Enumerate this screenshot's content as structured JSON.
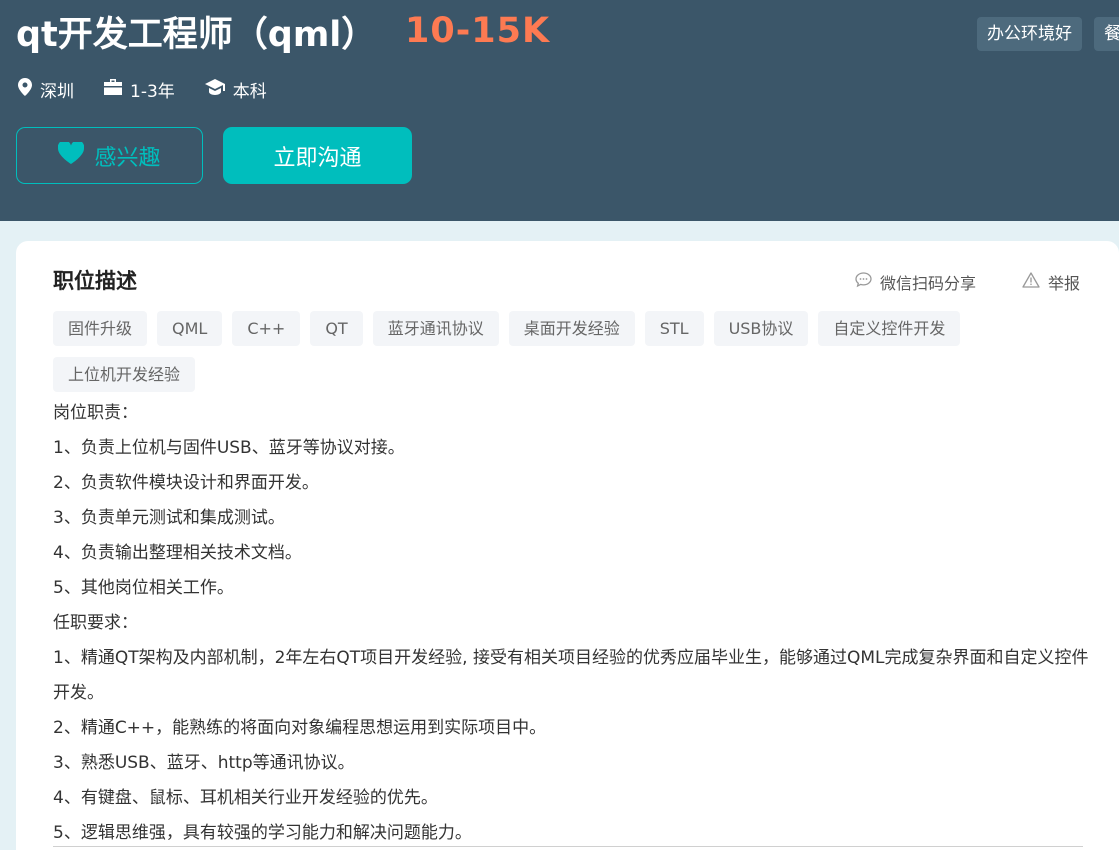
{
  "header": {
    "title": "qt开发工程师（qml）",
    "salary": "10-15K",
    "welfare": [
      "办公环境好",
      "餐"
    ],
    "meta": {
      "city": "深圳",
      "experience": "1-3年",
      "degree": "本科"
    },
    "buttons": {
      "interest": "感兴趣",
      "chat": "立即沟通"
    }
  },
  "card": {
    "section_title": "职位描述",
    "share_label": "微信扫码分享",
    "report_label": "举报",
    "tags": [
      "固件升级",
      "QML",
      "C++",
      "QT",
      "蓝牙通讯协议",
      "桌面开发经验",
      "STL",
      "USB协议",
      "自定义控件开发",
      "上位机开发经验"
    ],
    "description": [
      "岗位职责：",
      "1、负责上位机与固件USB、蓝牙等协议对接。",
      "2、负责软件模块设计和界面开发。",
      "3、负责单元测试和集成测试。",
      "4、负责输出整理相关技术文档。",
      "5、其他岗位相关工作。",
      "任职要求：",
      "1、精通QT架构及内部机制，2年左右QT项目开发经验, 接受有相关项目经验的优秀应届毕业生，能够通过QML完成复杂界面和自定义控件开发。",
      "2、精通C++，能熟练的将面向对象编程思想运用到实际项目中。",
      "3、熟悉USB、蓝牙、http等通讯协议。",
      "4、有键盘、鼠标、耳机相关行业开发经验的优先。",
      "5、逻辑思维强，具有较强的学习能力和解决问题能力。"
    ]
  },
  "colors": {
    "header_bg": "#3b5669",
    "accent": "#00bebd",
    "salary": "#fd7a52"
  }
}
